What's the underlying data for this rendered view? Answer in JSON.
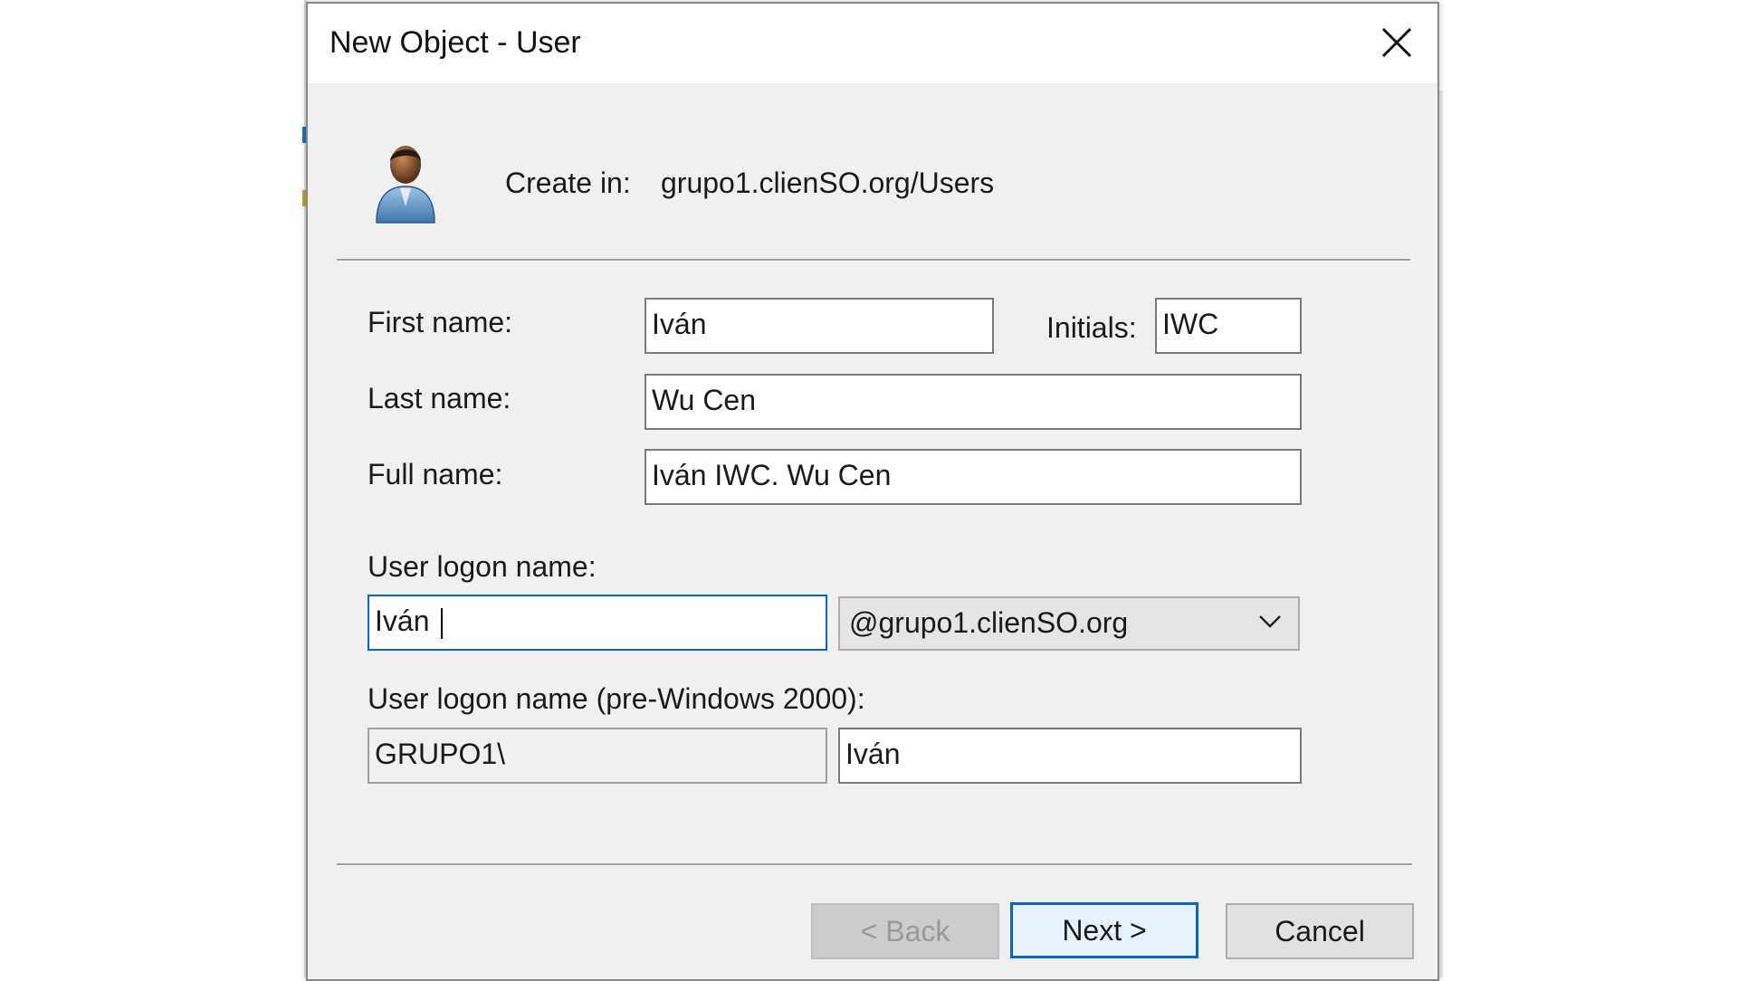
{
  "dialog": {
    "title": "New Object - User",
    "create_in_label": "Create in:",
    "create_in_path": "grupo1.clienSO.org/Users"
  },
  "icons": {
    "user": "user-icon",
    "close": "close-icon",
    "dropdown": "chevron-down-icon"
  },
  "form": {
    "first_name_label": "First name:",
    "first_name_value": "Iván",
    "initials_label": "Initials:",
    "initials_value": "IWC",
    "last_name_label": "Last name:",
    "last_name_value": "Wu Cen",
    "full_name_label": "Full name:",
    "full_name_value": "Iván IWC. Wu Cen",
    "logon_label": "User logon name:",
    "logon_value": "Iván ",
    "logon_domain": "@grupo1.clienSO.org",
    "pre2000_label": "User logon name (pre-Windows 2000):",
    "pre2000_domain": "GRUPO1\\",
    "pre2000_value": "Iván"
  },
  "buttons": {
    "back": "< Back",
    "next": "Next >",
    "cancel": "Cancel"
  },
  "colors": {
    "focus_border": "#0a63c9",
    "dialog_bg": "#f0f0f0"
  }
}
